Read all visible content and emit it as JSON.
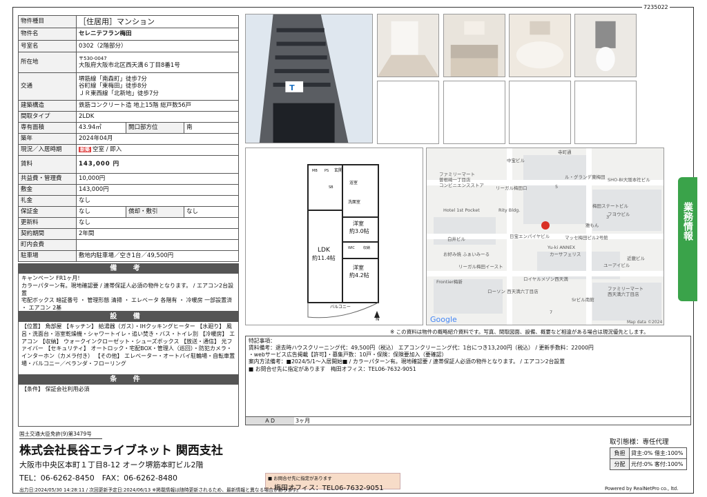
{
  "doc_id": "7235022",
  "property": {
    "type_label": "物件種目",
    "type_value": "［住居用］マンション",
    "name_label": "物件名",
    "name_value": "セレニテフラン梅田",
    "room_label": "号室名",
    "room_value": "0302（2階部分）",
    "addr_label": "所在地",
    "addr_zip": "〒530-0047",
    "addr_value": "大阪府大阪市北区西天満６丁目8番1号",
    "traffic_label": "交通",
    "traffic_1": "堺筋線「南森町」徒歩7分",
    "traffic_2": "谷町線「東梅田」徒歩8分",
    "traffic_3": "ＪＲ東西線「北新地」徒歩7分",
    "struct_label": "建築構造",
    "struct_value": "鉄筋コンクリート造 地上15階 総戸数56戸",
    "layout_label": "間取タイプ",
    "layout_value": "2LDK",
    "area_label": "専有面積",
    "area_value": "43.94㎡",
    "direction_label": "開口部方位",
    "direction_value": "南",
    "built_label": "築年",
    "built_value": "2024年04月",
    "status_label": "現況／入居時期",
    "status_badge": "新築",
    "status_value": "空室 / 即入",
    "rent_label": "賃料",
    "rent_value": "143,000 円",
    "fee_label": "共益費・管理費",
    "fee_value": "10,000円",
    "deposit_label": "敷金",
    "deposit_value": "143,000円",
    "key_label": "礼金",
    "key_value": "なし",
    "guarantee_label": "保証金",
    "guarantee_value": "なし",
    "amort_label": "償却・敷引",
    "amort_value": "なし",
    "renew_label": "更新料",
    "renew_value": "なし",
    "contract_label": "契約期間",
    "contract_value": "2年間",
    "town_label": "町内会費",
    "town_value": "",
    "parking_label": "駐車場",
    "parking_value": "敷地内駐車場／空き1台／49,500円"
  },
  "remarks_box": {
    "title": "備 考",
    "text": "キャンペーン FR1ヶ月!\nカラーパターン有。現地確認要 / 連帯保証人必須の物件となります。 / エアコン2台設置\n宅配ボックス 暗証番号 ・ 管理形態 清掃 ・ エレベータ 各階有 ・ 冷暖房 一部設置済 ・ エアコン 2基"
  },
  "equipment_box": {
    "title": "設 備",
    "text": "【位置】 角部屋 【キッチン】 給湯器（ガス）・IHクッキングヒーター 【水廻り】 風呂・洗面台・浴室乾燥機・シャワートイレ・追い焚き・バス・トイレ別 【冷暖房】 エアコン 【収納】 ウォークインクローゼット・シューズボックス 【放送・通信】 光ファイバー 【セキュリティ】 オートロック・宅配BOX・管理人（巡回）・防犯カメラ・インターホン（カメラ付き） 【その他】 エレベーター・オートバイ駐輪場・自転車置場・バルコニー／ベランダ・フローリング"
  },
  "conditions_box": {
    "title": "条 件",
    "text": "【条件】 保証会社利用必須"
  },
  "floorplan": {
    "ldk": "LDK",
    "ldk_size": "約11.4帖",
    "room1": "洋室",
    "room1_size": "約3.0帖",
    "room2": "洋室",
    "room2_size": "約4.2帖",
    "bath": "浴室",
    "wash": "洗面室",
    "balcony": "バルコニー",
    "wic": "WIC",
    "storage": "収納",
    "sb": "SB",
    "entrance": "玄関",
    "mb": "MB",
    "ps": "PS",
    "n": "N"
  },
  "map": {
    "labels": [
      "ファミリーマート",
      "曽根崎一丁目店",
      "コンビニエンスストア",
      "リーガル梅田口",
      "Hotel 1st Pocket",
      "Rity Bldg.",
      "梅田ステートビル",
      "フヨウビル",
      "雅もん",
      "マッセ梅田ビル2号館",
      "日宝エンパイヤビル",
      "Yu-ki ANNEX",
      "カーサフェリス",
      "ユーアイビル",
      "近畿ビル",
      "白井ビル",
      "お好み焼 ふぁいみーる",
      "リーガル梅田イースト",
      "ロイヤルメゾン西天満",
      "Frontier梅新",
      "ローソン 西天満六丁目店",
      "ファミリーマート",
      "西天満六丁目店",
      "Srビル南館",
      "中宝ビル",
      "寺町通",
      "ル・グランデ東梅田",
      "SHO-BI大阪本社ビル",
      "5",
      "3",
      "7"
    ],
    "google": "Google",
    "attribution": "Map data ©2024"
  },
  "disclaimer": "※ この資料は物件の概略紹介資料です。写真、間取図面、設備、概要など相違がある場合は現況優先とします。",
  "notes": {
    "title": "特記事項：",
    "lines": [
      "賃料備考：退去時ハウスクリーニング代：49,500円（税込） エアコンクリーニング代：1台につき13,200円（税込） / 更新手数料：22000円",
      "・webサービス広告掲載【許可】・募集戸数：10戸・保険：保険要加入（要確認）",
      "案内方法備考：■2024/5/1～入居開始■ / カラーパターン有。現地確認要 / 連帯保証人必須の物件となります。 / エアコン2台設置",
      "■ お問合せ先に指定があります　梅田オフィス：TEL06-7632-9051"
    ]
  },
  "ad": {
    "label": "ＡＤ",
    "value": "3ヶ月"
  },
  "side_tab": "業務情報",
  "company": {
    "license": "国土交通大臣免許(9)第3479号",
    "name": "株式会社長谷エライブネット 関西支社",
    "address": "大阪市中央区本町１丁目8-12 オーク堺筋本町ビル2階",
    "tel": "TEL：06-6262-8450　FAX：06-6262-8480"
  },
  "trade": {
    "title": "取引態様：専任代理",
    "burden_label": "負担",
    "burden_value": "貸主:0% 借主:100%",
    "split_label": "分配",
    "split_value": "元付:0% 客付:100%"
  },
  "inquiry": {
    "note": "■ お問合せ先に指定があります",
    "office": "梅田オフィス：TEL06-7632-9051"
  },
  "footer": {
    "line": "出力日:2024/05/30 14:28:11 / 次回更新予定日:2024/06/13 ※掲載情報は随時更新されるため、最新情報と異なる場合があります。",
    "powered": "Powered by RealNetPro co., ltd."
  },
  "colors": {
    "side_tab": "#3aa34a",
    "badge_new": "#e04040",
    "inquiry_bg": "#f7dcc8"
  }
}
